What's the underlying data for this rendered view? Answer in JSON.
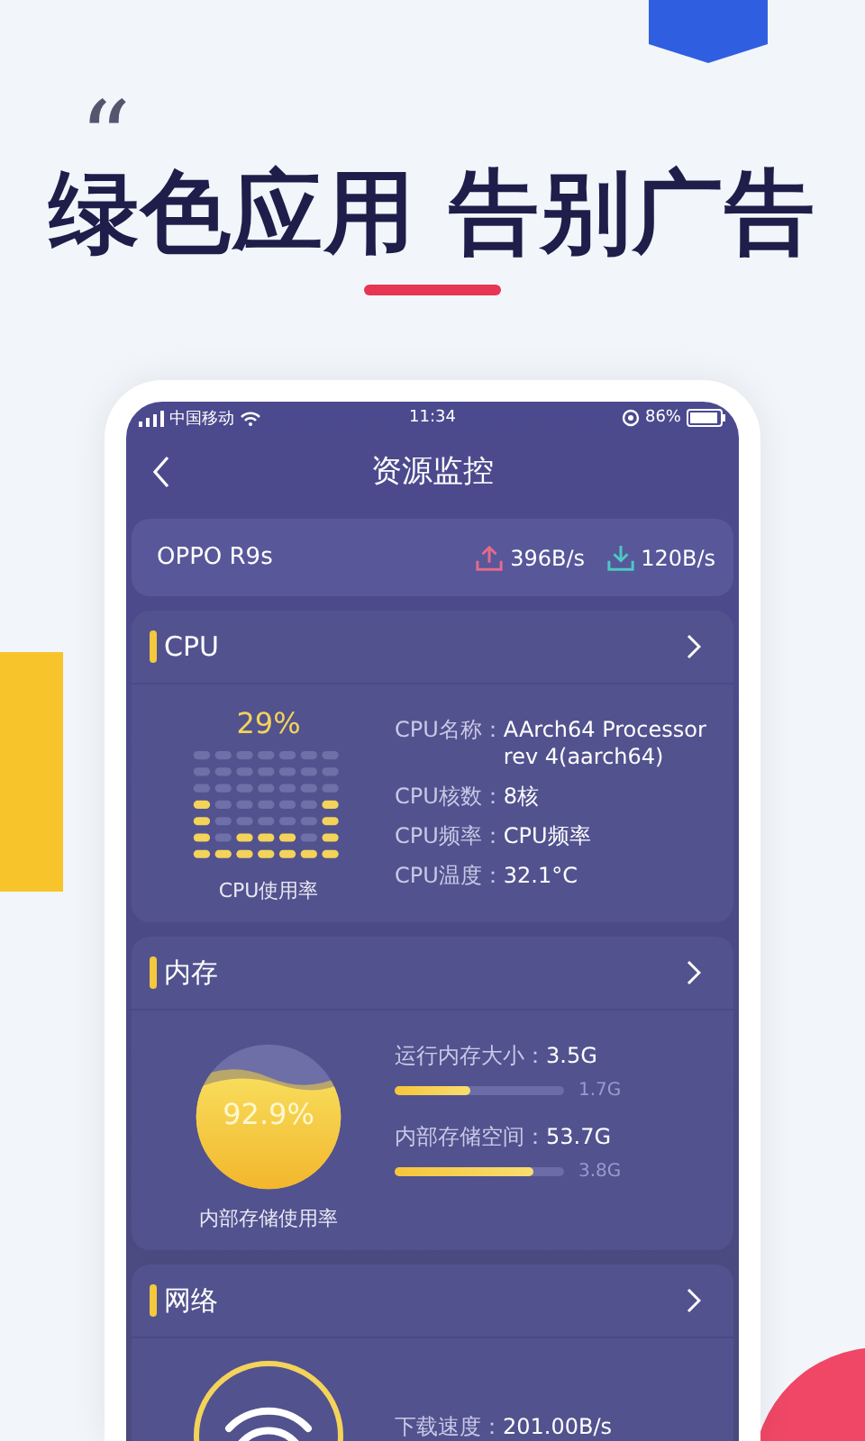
{
  "headline": {
    "quote_mark": "“",
    "title": "绿色应用 告别广告"
  },
  "status_bar": {
    "carrier": "中国移动",
    "time": "11:34",
    "battery": "86%"
  },
  "nav": {
    "title": "资源监控"
  },
  "device": {
    "name": "OPPO R9s",
    "upload": "396B/s",
    "download": "120B/s"
  },
  "cpu": {
    "title": "CPU",
    "usage": "29%",
    "caption": "CPU使用率",
    "specs": [
      {
        "label": "CPU名称：",
        "value": "AArch64 Processor rev 4(aarch64)"
      },
      {
        "label": "CPU核数：",
        "value": "8核"
      },
      {
        "label": "CPU频率：",
        "value": "CPU频率"
      },
      {
        "label": "CPU温度：",
        "value": "32.1°C"
      }
    ]
  },
  "memory": {
    "title": "内存",
    "usage": "92.9%",
    "caption": "内部存储使用率",
    "bars": [
      {
        "label": "运行内存大小：",
        "value": "3.5G",
        "level": 0.45,
        "reading": "1.7G"
      },
      {
        "label": "内部存储空间：",
        "value": "53.7G",
        "level": 0.82,
        "reading": "3.8G"
      }
    ]
  },
  "network": {
    "title": "网络",
    "rows": [
      {
        "label": "下载速度：",
        "value": "201.00B/s"
      }
    ]
  }
}
